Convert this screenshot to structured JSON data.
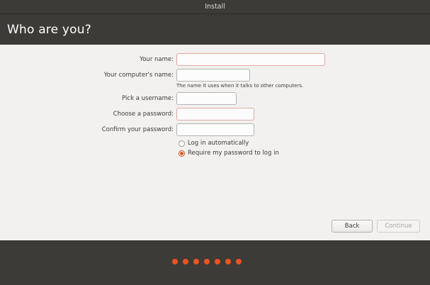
{
  "window": {
    "title": "Install"
  },
  "page": {
    "title": "Who are you?"
  },
  "form": {
    "your_name": {
      "label": "Your name:",
      "value": ""
    },
    "computer_name": {
      "label": "Your computer's name:",
      "value": "",
      "hint": "The name it uses when it talks to other computers."
    },
    "username": {
      "label": "Pick a username:",
      "value": ""
    },
    "password": {
      "label": "Choose a password:",
      "value": ""
    },
    "confirm_password": {
      "label": "Confirm your password:",
      "value": ""
    },
    "login_options": [
      {
        "label": "Log in automatically",
        "checked": false
      },
      {
        "label": "Require my password to log in",
        "checked": true
      }
    ]
  },
  "buttons": {
    "back": "Back",
    "continue": "Continue"
  },
  "progress": {
    "total_steps": 7
  },
  "colors": {
    "accent": "#e95420",
    "chrome": "#3c3b37",
    "background": "#f2f1f0"
  }
}
